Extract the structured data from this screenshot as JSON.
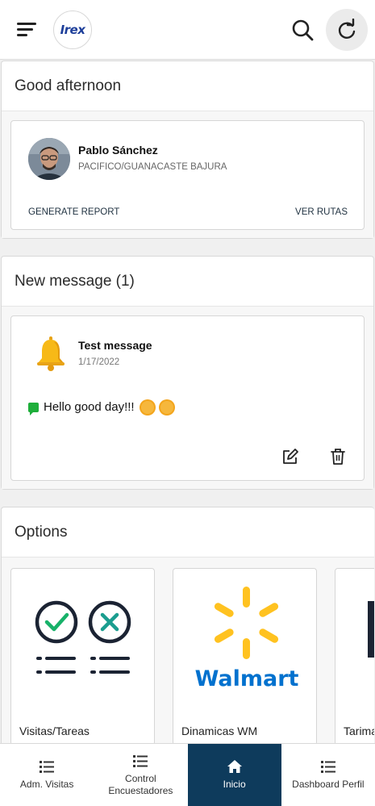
{
  "header": {
    "logo_text": "Irex",
    "menu_icon": "menu-icon",
    "search_icon": "search-icon",
    "refresh_icon": "refresh-icon"
  },
  "greeting": {
    "title": "Good afternoon",
    "user_name": "Pablo Sánchez",
    "user_region": "PACIFICO/GUANACASTE BAJURA",
    "generate_report_label": "GENERATE REPORT",
    "ver_rutas_label": "VER RUTAS"
  },
  "messages": {
    "title": "New message (1)",
    "item": {
      "title": "Test message",
      "date": "1/17/2022",
      "text": "Hello good day!!!",
      "icon": "bell-icon"
    }
  },
  "options": {
    "title": "Options",
    "items": [
      {
        "label": "Visitas/Tareas",
        "icon": "checklist-icon"
      },
      {
        "label": "Dinamicas WM",
        "icon": "walmart-logo",
        "logo_text": "Walmart"
      },
      {
        "label": "Tarimas",
        "icon": "tarima-icon"
      }
    ]
  },
  "bottom_nav": {
    "items": [
      {
        "label": "Adm. Visitas",
        "active": false
      },
      {
        "label": "Control Encuestadores",
        "active": false
      },
      {
        "label": "Inicio",
        "active": true
      },
      {
        "label": "Dashboard Perfil",
        "active": false
      }
    ]
  },
  "colors": {
    "active_nav": "#0e3b5c",
    "walmart_blue": "#0071ce",
    "walmart_yellow": "#ffc220",
    "check_green": "#17b169",
    "cross_teal": "#1a9d8f"
  }
}
